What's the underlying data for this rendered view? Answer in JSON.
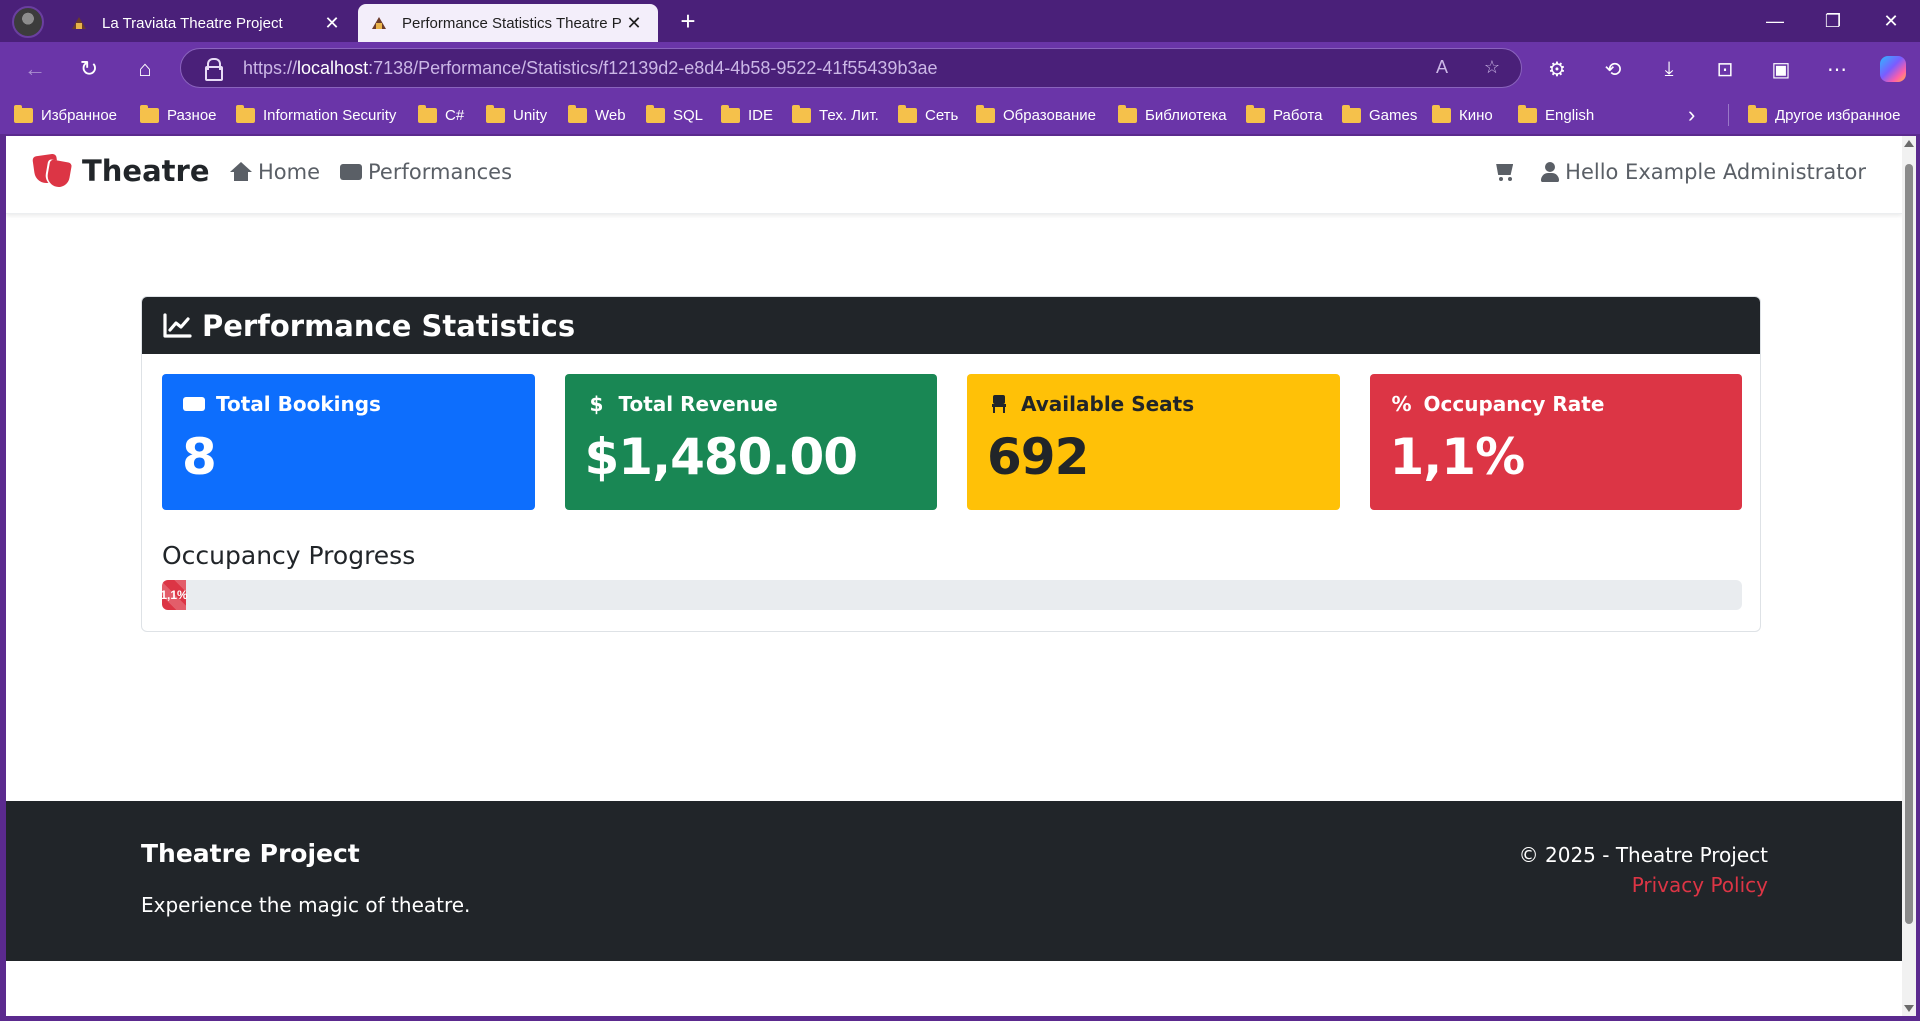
{
  "browser": {
    "tabs": [
      {
        "title": "La Traviata Theatre Project",
        "active": false
      },
      {
        "title": "Performance Statistics Theatre Pro",
        "active": true
      }
    ],
    "url": {
      "prefix": "https://",
      "host": "localhost",
      "path": ":7138/Performance/Statistics/f12139d2-e8d4-4b58-9522-41f55439b3ae"
    },
    "bookmarks": [
      "Избранное",
      "Разное",
      "Information Security",
      "C#",
      "Unity",
      "Web",
      "SQL",
      "IDE",
      "Тех. Лит.",
      "Сеть",
      "Образование",
      "Библиотека",
      "Работа",
      "Games",
      "Кино",
      "English"
    ],
    "other_bookmarks": "Другое избранное"
  },
  "site": {
    "brand": "Theatre",
    "nav": {
      "home": "Home",
      "performances": "Performances"
    },
    "user_greeting": "Hello Example Administrator"
  },
  "stats": {
    "title": "Performance Statistics",
    "tiles": [
      {
        "label": "Total Bookings",
        "value": "8",
        "icon": "ticket-icon",
        "color": "#0d6efd"
      },
      {
        "label": "Total Revenue",
        "value": "$1,480.00",
        "icon": "dollar-icon",
        "color": "#198754"
      },
      {
        "label": "Available Seats",
        "value": "692",
        "icon": "chair-icon",
        "color": "#ffc107"
      },
      {
        "label": "Occupancy Rate",
        "value": "1,1%",
        "icon": "percent-icon",
        "color": "#dc3545"
      }
    ],
    "progress_label": "Occupancy Progress",
    "progress_text": "1,1%",
    "progress_percent": 1.1
  },
  "footer": {
    "brand": "Theatre Project",
    "tagline": "Experience the magic of theatre.",
    "copyright": "© 2025 - Theatre Project",
    "privacy": "Privacy Policy"
  }
}
